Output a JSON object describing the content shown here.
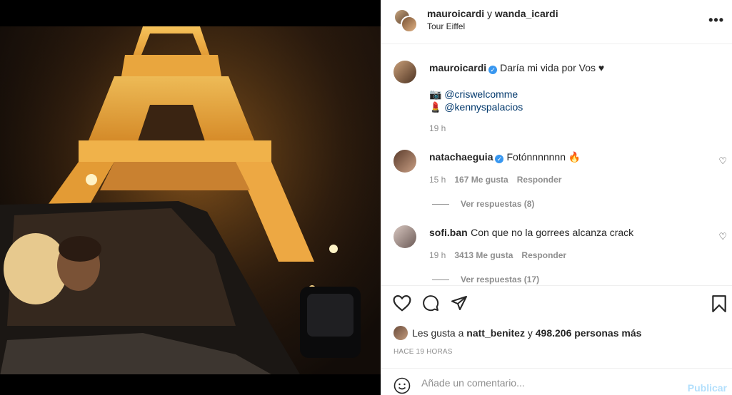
{
  "header": {
    "user1": "mauroicardi",
    "connector": "y",
    "user2": "wanda_icardi",
    "location": "Tour Eiffel"
  },
  "caption": {
    "username": "mauroicardi",
    "text": "Daría mi vida por Vos ♥",
    "credit1_icon": "📷",
    "credit1": "@criswelcomme",
    "credit2_icon": "💄",
    "credit2": "@kennyspalacios",
    "time": "19 h"
  },
  "comments": [
    {
      "username": "natachaeguia",
      "verified": true,
      "text": "Fotónnnnnnn 🔥",
      "time": "15 h",
      "likes": "167 Me gusta",
      "reply": "Responder",
      "view_replies": "Ver respuestas (8)"
    },
    {
      "username": "sofi.ban",
      "verified": false,
      "text": "Con que no la gorrees alcanza crack",
      "time": "19 h",
      "likes": "3413 Me gusta",
      "reply": "Responder",
      "view_replies": "Ver respuestas (17)"
    }
  ],
  "likes": {
    "prefix": "Les gusta a",
    "user": "natt_benitez",
    "middle": "y",
    "count": "498.206 personas más"
  },
  "time_ago": "HACE 19 HORAS",
  "comment_box": {
    "placeholder": "Añade un comentario...",
    "publish_label": "Publicar"
  },
  "icons": [
    "more-icon",
    "heart-icon",
    "comment-icon",
    "share-icon",
    "bookmark-icon",
    "emoji-icon",
    "verified-icon"
  ],
  "colors": {
    "link": "#00376b",
    "verified": "#3897f0",
    "publish": "#b2dffc",
    "muted": "#8e8e8e"
  }
}
